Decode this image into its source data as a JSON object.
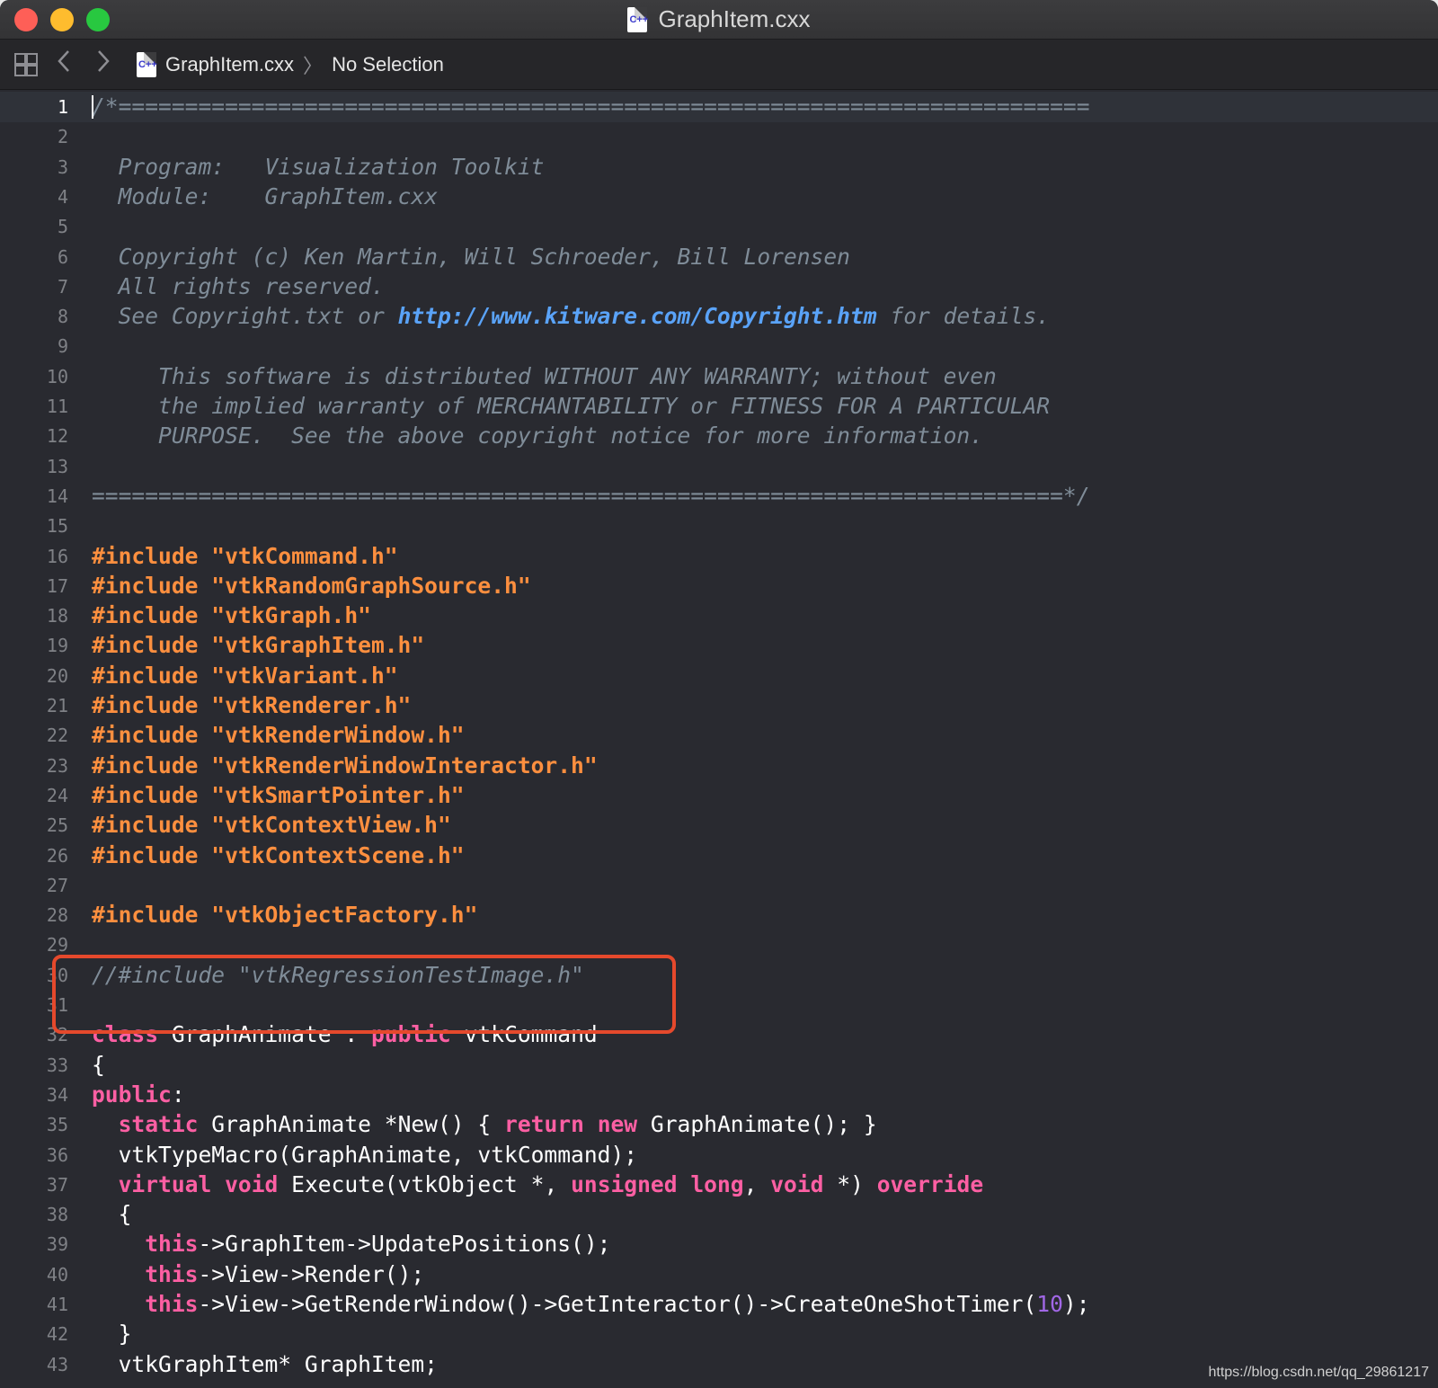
{
  "window": {
    "title": "GraphItem.cxx",
    "file_icon_label": "C++"
  },
  "jumpbar": {
    "back_icon": "chevron-left-icon",
    "forward_icon": "chevron-right-icon",
    "file_label": "GraphItem.cxx",
    "separator": "〉",
    "selection_label": "No Selection"
  },
  "editor": {
    "current_line": 1,
    "colors": {
      "background": "#292a30",
      "comment": "#7f8c98",
      "preprocessor": "#fd8f3f",
      "keyword": "#fc5fa3",
      "url": "#5aa3f8",
      "number": "#a167e6",
      "highlight_box": "#e5492c"
    },
    "lines": [
      {
        "n": "1",
        "text": "/*=========================================================================",
        "kind": "cm"
      },
      {
        "n": "2",
        "text": "",
        "kind": "cm"
      },
      {
        "n": "3",
        "text": "  Program:   Visualization Toolkit",
        "kind": "cm"
      },
      {
        "n": "4",
        "text": "  Module:    GraphItem.cxx",
        "kind": "cm"
      },
      {
        "n": "5",
        "text": "",
        "kind": "cm"
      },
      {
        "n": "6",
        "text": "  Copyright (c) Ken Martin, Will Schroeder, Bill Lorensen",
        "kind": "cm"
      },
      {
        "n": "7",
        "text": "  All rights reserved.",
        "kind": "cm"
      },
      {
        "n": "8",
        "pre": "  See Copyright.txt or ",
        "url": "http://www.kitware.com/Copyright.htm",
        "post": " for details.",
        "kind": "url"
      },
      {
        "n": "9",
        "text": "",
        "kind": "cm"
      },
      {
        "n": "10",
        "text": "     This software is distributed WITHOUT ANY WARRANTY; without even",
        "kind": "cm"
      },
      {
        "n": "11",
        "text": "     the implied warranty of MERCHANTABILITY or FITNESS FOR A PARTICULAR",
        "kind": "cm"
      },
      {
        "n": "12",
        "text": "     PURPOSE.  See the above copyright notice for more information.",
        "kind": "cm"
      },
      {
        "n": "13",
        "text": "",
        "kind": "cm"
      },
      {
        "n": "14",
        "text": "=========================================================================*/",
        "kind": "cm"
      },
      {
        "n": "15",
        "text": "",
        "kind": "plain"
      },
      {
        "n": "16",
        "text": "#include \"vtkCommand.h\"",
        "kind": "pp"
      },
      {
        "n": "17",
        "text": "#include \"vtkRandomGraphSource.h\"",
        "kind": "pp"
      },
      {
        "n": "18",
        "text": "#include \"vtkGraph.h\"",
        "kind": "pp"
      },
      {
        "n": "19",
        "text": "#include \"vtkGraphItem.h\"",
        "kind": "pp"
      },
      {
        "n": "20",
        "text": "#include \"vtkVariant.h\"",
        "kind": "pp"
      },
      {
        "n": "21",
        "text": "#include \"vtkRenderer.h\"",
        "kind": "pp"
      },
      {
        "n": "22",
        "text": "#include \"vtkRenderWindow.h\"",
        "kind": "pp"
      },
      {
        "n": "23",
        "text": "#include \"vtkRenderWindowInteractor.h\"",
        "kind": "pp"
      },
      {
        "n": "24",
        "text": "#include \"vtkSmartPointer.h\"",
        "kind": "pp"
      },
      {
        "n": "25",
        "text": "#include \"vtkContextView.h\"",
        "kind": "pp"
      },
      {
        "n": "26",
        "text": "#include \"vtkContextScene.h\"",
        "kind": "pp"
      },
      {
        "n": "27",
        "text": "",
        "kind": "plain"
      },
      {
        "n": "28",
        "text": "#include \"vtkObjectFactory.h\"",
        "kind": "pp"
      },
      {
        "n": "29",
        "text": "",
        "kind": "plain"
      },
      {
        "n": "30",
        "text": "//#include \"vtkRegressionTestImage.h\"",
        "kind": "cm"
      },
      {
        "n": "31",
        "text": "",
        "kind": "plain"
      },
      {
        "n": "32",
        "tokens": [
          [
            "kw",
            "class"
          ],
          [
            "plain",
            " GraphAnimate : "
          ],
          [
            "kw",
            "public"
          ],
          [
            "plain",
            " vtkCommand"
          ]
        ],
        "kind": "tokens"
      },
      {
        "n": "33",
        "text": "{",
        "kind": "plain"
      },
      {
        "n": "34",
        "tokens": [
          [
            "kw",
            "public"
          ],
          [
            "plain",
            ":"
          ]
        ],
        "kind": "tokens"
      },
      {
        "n": "35",
        "tokens": [
          [
            "plain",
            "  "
          ],
          [
            "kw",
            "static"
          ],
          [
            "plain",
            " GraphAnimate *New() { "
          ],
          [
            "kw",
            "return"
          ],
          [
            "plain",
            " "
          ],
          [
            "kw",
            "new"
          ],
          [
            "plain",
            " GraphAnimate(); }"
          ]
        ],
        "kind": "tokens"
      },
      {
        "n": "36",
        "text": "  vtkTypeMacro(GraphAnimate, vtkCommand);",
        "kind": "plain"
      },
      {
        "n": "37",
        "tokens": [
          [
            "plain",
            "  "
          ],
          [
            "kw",
            "virtual"
          ],
          [
            "plain",
            " "
          ],
          [
            "kw",
            "void"
          ],
          [
            "plain",
            " Execute(vtkObject *, "
          ],
          [
            "kw",
            "unsigned"
          ],
          [
            "plain",
            " "
          ],
          [
            "kw",
            "long"
          ],
          [
            "plain",
            ", "
          ],
          [
            "kw",
            "void"
          ],
          [
            "plain",
            " *) "
          ],
          [
            "kw",
            "override"
          ]
        ],
        "kind": "tokens"
      },
      {
        "n": "38",
        "text": "  {",
        "kind": "plain"
      },
      {
        "n": "39",
        "tokens": [
          [
            "plain",
            "    "
          ],
          [
            "kw",
            "this"
          ],
          [
            "plain",
            "->GraphItem->UpdatePositions();"
          ]
        ],
        "kind": "tokens"
      },
      {
        "n": "40",
        "tokens": [
          [
            "plain",
            "    "
          ],
          [
            "kw",
            "this"
          ],
          [
            "plain",
            "->View->Render();"
          ]
        ],
        "kind": "tokens"
      },
      {
        "n": "41",
        "tokens": [
          [
            "plain",
            "    "
          ],
          [
            "kw",
            "this"
          ],
          [
            "plain",
            "->View->GetRenderWindow()->GetInteractor()->CreateOneShotTimer("
          ],
          [
            "num2",
            "10"
          ],
          [
            "plain",
            ");"
          ]
        ],
        "kind": "tokens"
      },
      {
        "n": "42",
        "text": "  }",
        "kind": "plain"
      },
      {
        "n": "43",
        "text": "  vtkGraphItem* GraphItem;",
        "kind": "plain"
      }
    ]
  },
  "watermark": "https://blog.csdn.net/qq_29861217"
}
